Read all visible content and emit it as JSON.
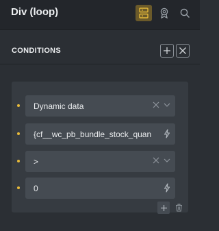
{
  "header": {
    "title": "Div (loop)",
    "icons": [
      "layers-icon",
      "badge-icon",
      "search-icon"
    ],
    "accent": "#6b5a2a"
  },
  "conditions": {
    "title": "CONDITIONS",
    "rows": [
      {
        "value": "Dynamic data",
        "control": "select"
      },
      {
        "value": "{cf__wc_pb_bundle_stock_quan",
        "control": "dynamic"
      },
      {
        "value": ">",
        "control": "select"
      },
      {
        "value": "0",
        "control": "dynamic"
      }
    ],
    "dot_color": "#e6b93a"
  }
}
